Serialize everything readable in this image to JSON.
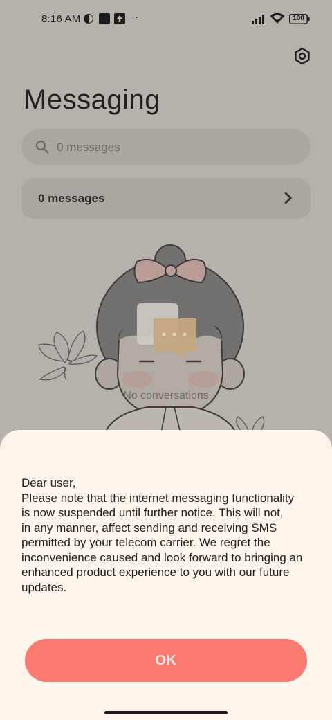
{
  "status_bar": {
    "time": "8:16 AM",
    "battery": "100",
    "more_indicator": "··"
  },
  "header": {
    "title": "Messaging",
    "settings_icon": "gear-hex-icon"
  },
  "search": {
    "placeholder": "0 messages"
  },
  "folder": {
    "label": "0 messages"
  },
  "empty_state": {
    "text": "No conversations"
  },
  "dialog": {
    "message_lines": [
      "Dear user,",
      "Please note that the internet messaging functionality",
      "is now suspended until further notice. This will not,",
      "in any manner, affect sending and receiving SMS",
      "permitted by your telecom carrier. We regret the",
      "inconvenience caused and look forward to bringing an",
      "enhanced product experience to you with our future",
      "updates."
    ],
    "ok_label": "OK"
  },
  "colors": {
    "accent": "#f97b72",
    "sheet_bg": "#fdf5ec",
    "dim_bg": "#b5b2ab"
  }
}
